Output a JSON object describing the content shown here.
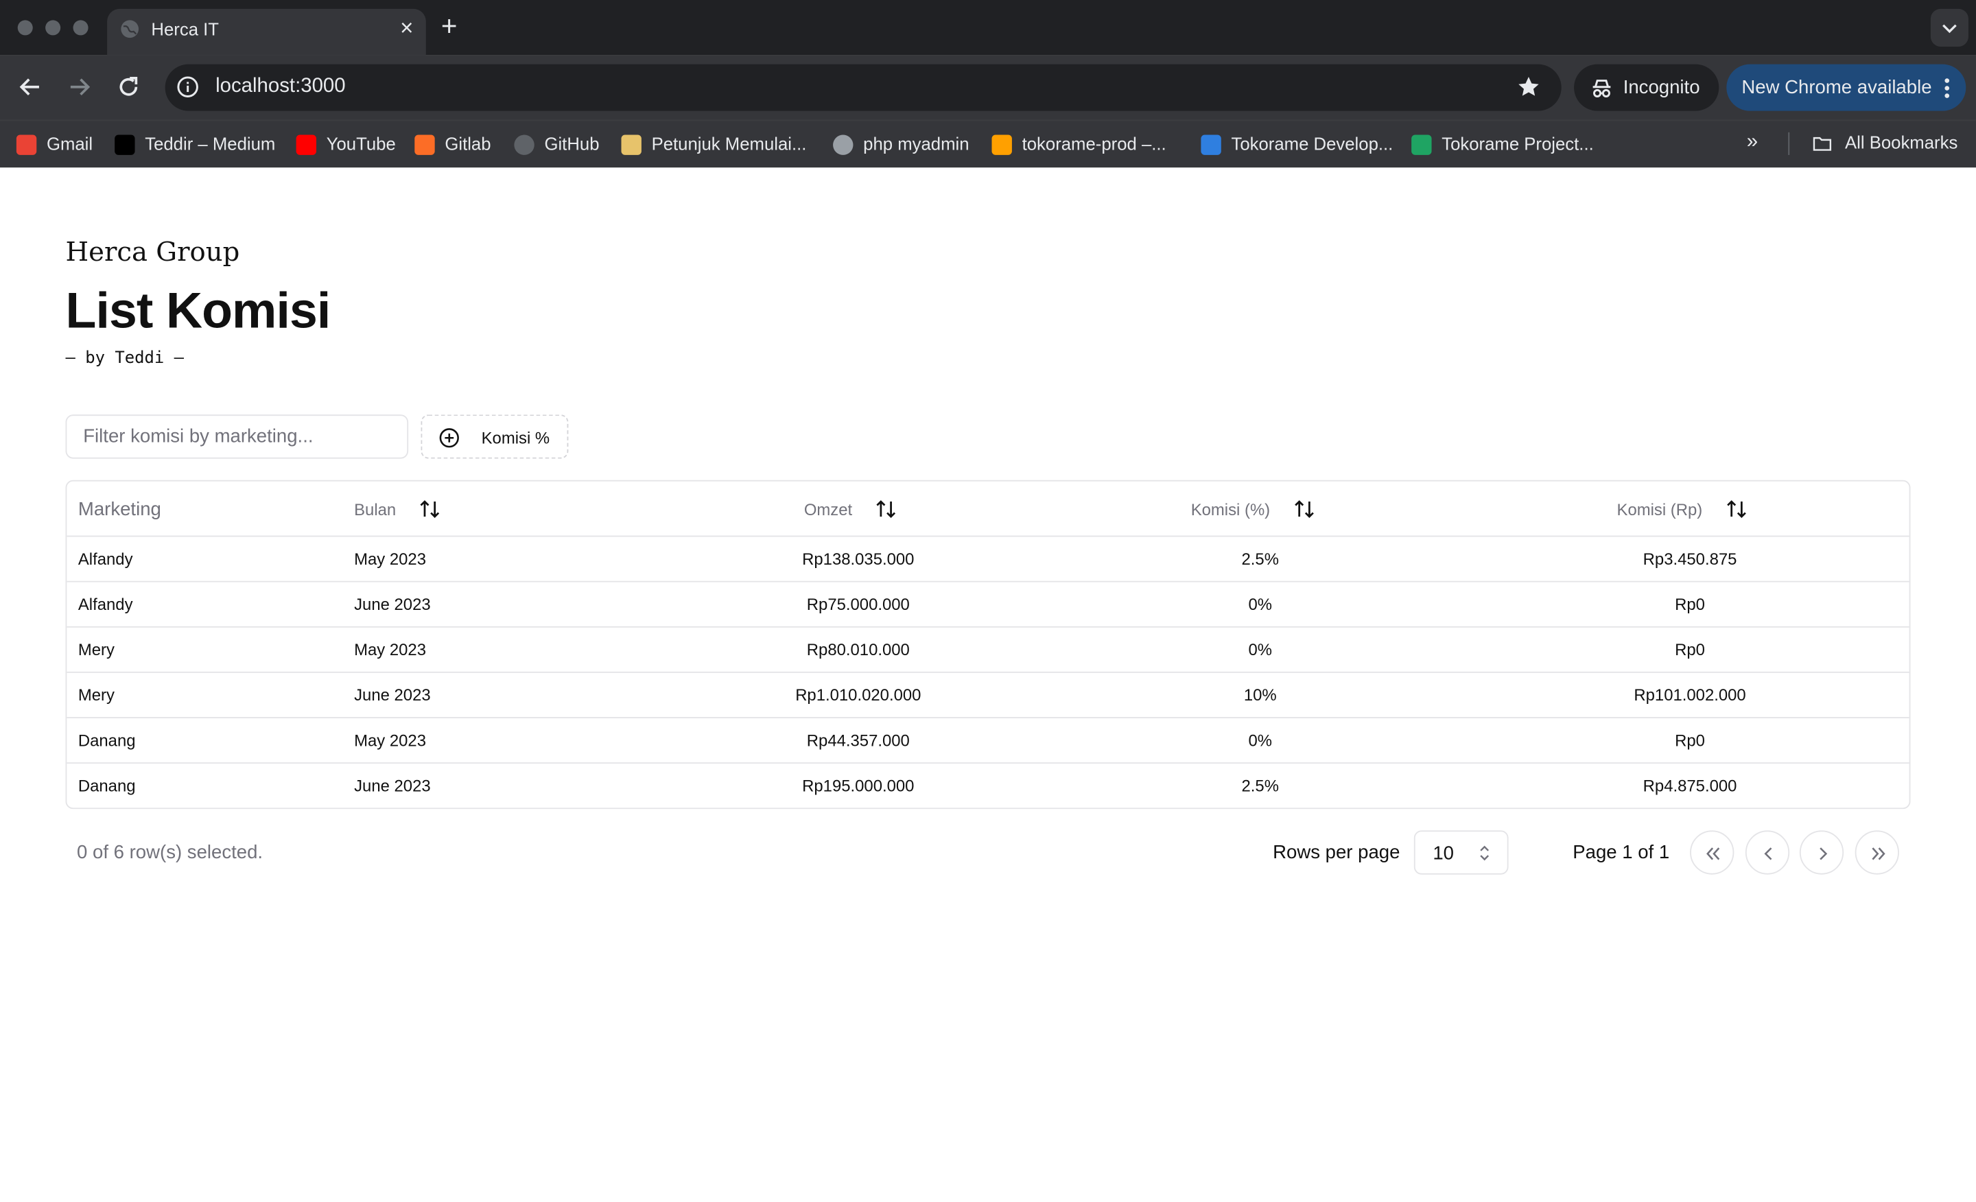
{
  "browser": {
    "tab_title": "Herca IT",
    "tab_close": "×",
    "new_tab": "+",
    "url": "localhost:3000",
    "incognito_label": "Incognito",
    "update_label": "New Chrome available",
    "bookmarks": [
      {
        "label": "Gmail",
        "icon": "gmail-icon",
        "color": "#ea4335"
      },
      {
        "label": "Teddir – Medium",
        "icon": "medium-icon",
        "color": "#000000"
      },
      {
        "label": "YouTube",
        "icon": "youtube-icon",
        "color": "#ff0000"
      },
      {
        "label": "Gitlab",
        "icon": "gitlab-icon",
        "color": "#fc6d26"
      },
      {
        "label": "GitHub",
        "icon": "github-icon",
        "color": "#5f6368"
      },
      {
        "label": "Petunjuk Memulai...",
        "icon": "note-icon",
        "color": "#e7c36b"
      },
      {
        "label": "php myadmin",
        "icon": "globe-icon",
        "color": "#9aa0a6"
      },
      {
        "label": "tokorame-prod –...",
        "icon": "firebase-icon",
        "color": "#ffa000"
      },
      {
        "label": "Tokorame Develop...",
        "icon": "trello-icon",
        "color": "#2f7fe0"
      },
      {
        "label": "Tokorame Project...",
        "icon": "sheets-icon",
        "color": "#1fa463"
      }
    ],
    "more_bookmarks": "»",
    "all_bookmarks": "All Bookmarks"
  },
  "page": {
    "brand": "Herca Group",
    "title": "List Komisi",
    "byline": "– by Teddi –",
    "filter_placeholder": "Filter komisi by marketing...",
    "facet_label": "Komisi %"
  },
  "table": {
    "columns": {
      "marketing": "Marketing",
      "bulan": "Bulan",
      "omzet": "Omzet",
      "komisi_pct": "Komisi (%)",
      "komisi_rp": "Komisi (Rp)"
    },
    "rows": [
      {
        "marketing": "Alfandy",
        "bulan": "May 2023",
        "omzet": "Rp138.035.000",
        "komisi_pct": "2.5%",
        "komisi_rp": "Rp3.450.875"
      },
      {
        "marketing": "Alfandy",
        "bulan": "June 2023",
        "omzet": "Rp75.000.000",
        "komisi_pct": "0%",
        "komisi_rp": "Rp0"
      },
      {
        "marketing": "Mery",
        "bulan": "May 2023",
        "omzet": "Rp80.010.000",
        "komisi_pct": "0%",
        "komisi_rp": "Rp0"
      },
      {
        "marketing": "Mery",
        "bulan": "June 2023",
        "omzet": "Rp1.010.020.000",
        "komisi_pct": "10%",
        "komisi_rp": "Rp101.002.000"
      },
      {
        "marketing": "Danang",
        "bulan": "May 2023",
        "omzet": "Rp44.357.000",
        "komisi_pct": "0%",
        "komisi_rp": "Rp0"
      },
      {
        "marketing": "Danang",
        "bulan": "June 2023",
        "omzet": "Rp195.000.000",
        "komisi_pct": "2.5%",
        "komisi_rp": "Rp4.875.000"
      }
    ]
  },
  "footer": {
    "selection": "0 of 6 row(s) selected.",
    "rows_per_page_label": "Rows per page",
    "rows_per_page_value": "10",
    "page_info": "Page 1 of 1"
  }
}
